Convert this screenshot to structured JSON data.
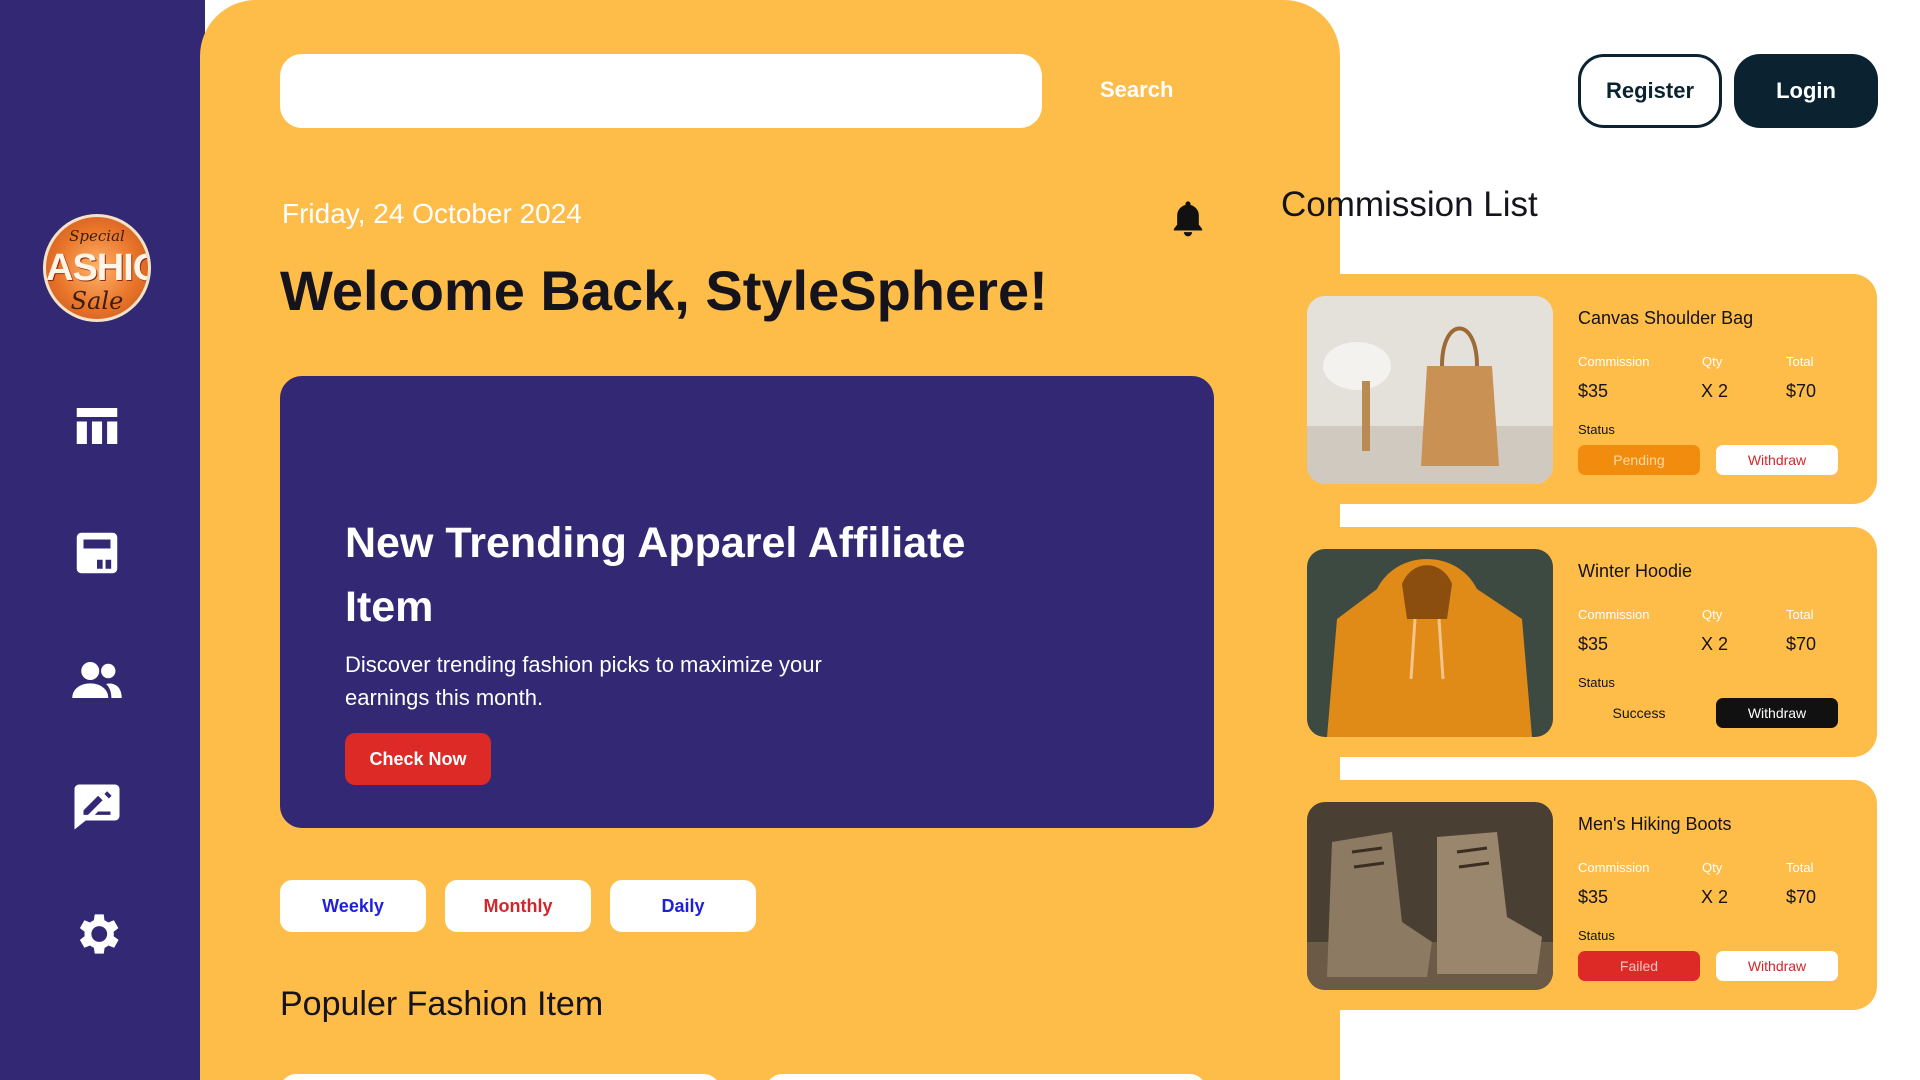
{
  "header": {
    "search_placeholder": "",
    "search_label": "Search",
    "register_label": "Register",
    "login_label": "Login"
  },
  "sidebar": {
    "logo": {
      "line1": "Special",
      "line2": "ASHION",
      "line3": "Sale"
    },
    "items": [
      {
        "icon": "table-icon"
      },
      {
        "icon": "calculator-icon"
      },
      {
        "icon": "users-icon"
      },
      {
        "icon": "feedback-icon"
      },
      {
        "icon": "gear-icon"
      }
    ]
  },
  "main": {
    "date": "Friday, 24 October 2024",
    "welcome": "Welcome Back, StyleSphere!",
    "banner": {
      "title": "New Trending Apparel Affiliate Item",
      "description": "Discover trending fashion picks to maximize your earnings this month.",
      "button": "Check Now"
    },
    "periods": [
      {
        "label": "Weekly",
        "color": "#1F1FE0"
      },
      {
        "label": "Monthly",
        "color": "#D3262A"
      },
      {
        "label": "Daily",
        "color": "#1F1FE0"
      }
    ],
    "popular_title": "Populer Fashion Item"
  },
  "commission": {
    "title": "Commission List",
    "labels": {
      "commission": "Commission",
      "qty": "Qty",
      "total": "Total",
      "status": "Status",
      "withdraw": "Withdraw"
    },
    "items": [
      {
        "name": "Canvas Shoulder Bag",
        "commission": "$35",
        "qty": "X 2",
        "total": "$70",
        "status": "Pending",
        "status_color": "#F28C0F",
        "status_text_color": "#FFD9A0",
        "withdraw_bg": "#FFFFFF",
        "withdraw_color": "#D3262A"
      },
      {
        "name": "Winter Hoodie",
        "commission": "$35",
        "qty": "X 2",
        "total": "$70",
        "status": "Success",
        "status_color": "transparent",
        "status_text_color": "#15131B",
        "withdraw_bg": "#111111",
        "withdraw_color": "#FFFFFF"
      },
      {
        "name": "Men's Hiking Boots",
        "commission": "$35",
        "qty": "X 2",
        "total": "$70",
        "status": "Failed",
        "status_color": "#DE2A27",
        "status_text_color": "#FFC1C1",
        "withdraw_bg": "#FFFFFF",
        "withdraw_color": "#D3262A"
      }
    ]
  },
  "colors": {
    "sidebar": "#322874",
    "main": "#FEBC48",
    "banner": "#322874",
    "dark": "#0B2331",
    "accent_red": "#DE2A27"
  }
}
